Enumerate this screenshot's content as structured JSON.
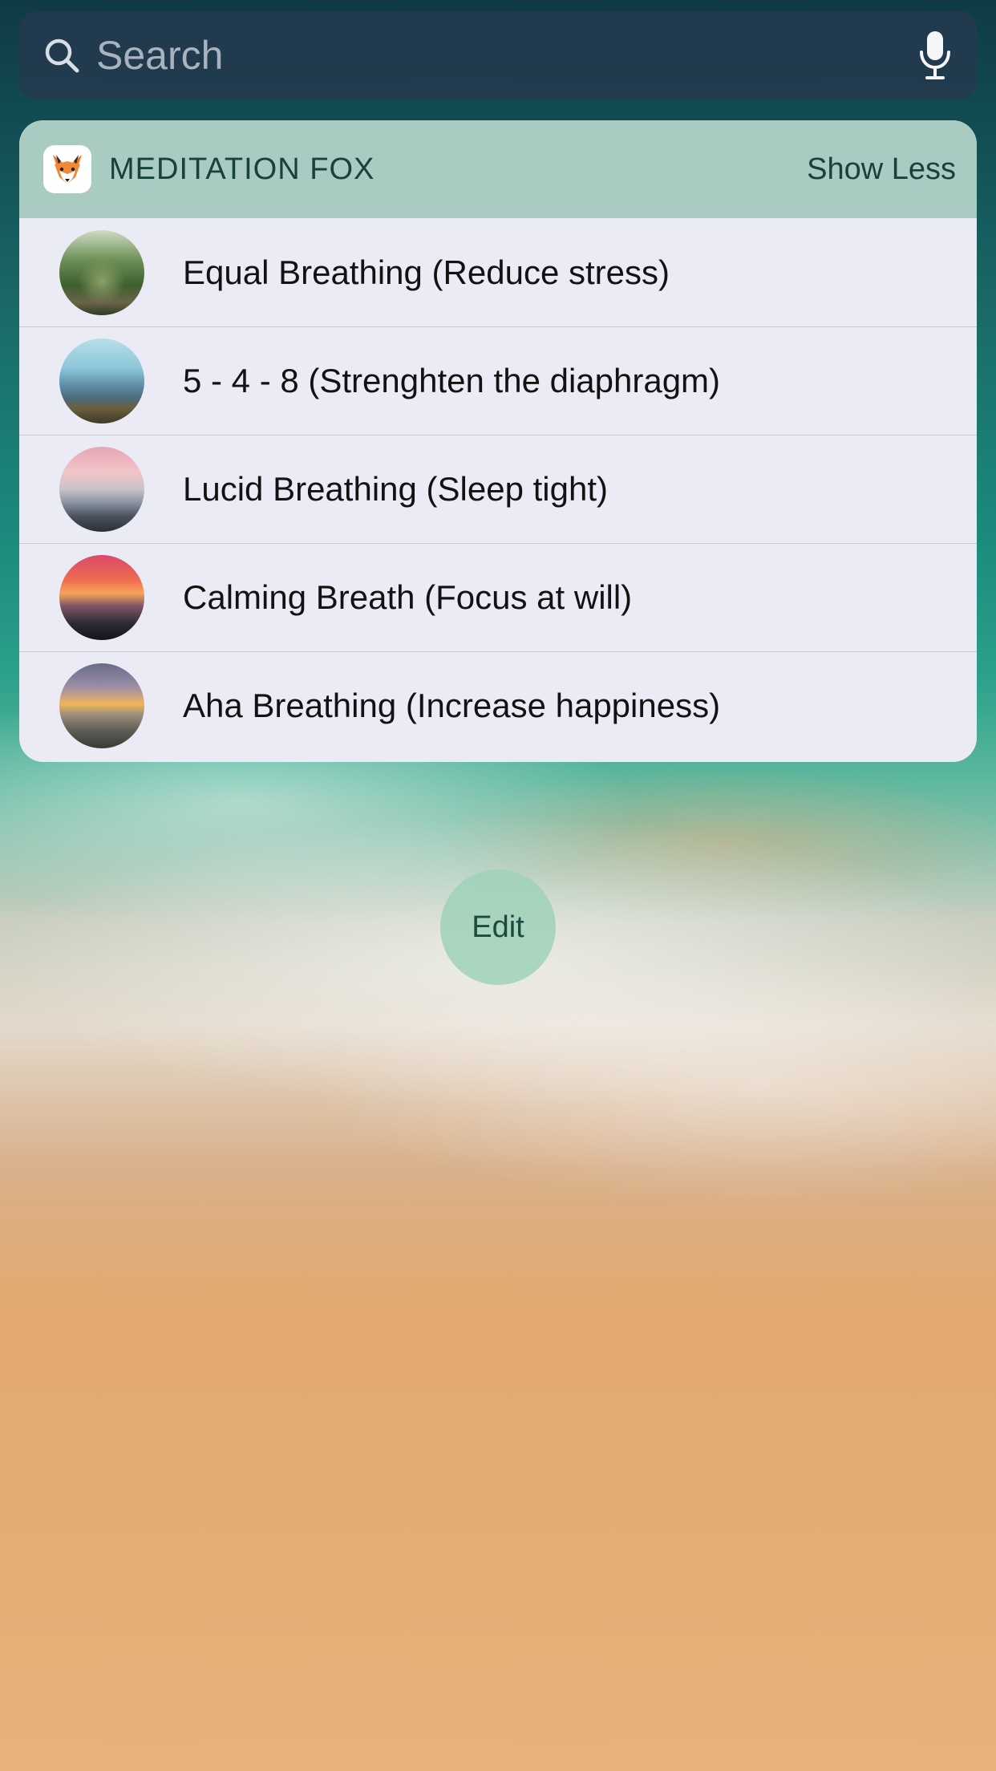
{
  "search": {
    "placeholder": "Search"
  },
  "icons": {
    "search": "search-icon",
    "mic": "microphone-icon",
    "app": "fox-icon"
  },
  "widget": {
    "app_name": "MEDITATION FOX",
    "show_less_label": "Show Less",
    "items": [
      {
        "title": "Equal Breathing (Reduce stress)",
        "thumb": "forest-path-image"
      },
      {
        "title": "5 - 4 - 8 (Strenghten the diaphragm)",
        "thumb": "mountain-lake-image"
      },
      {
        "title": "Lucid Breathing (Sleep tight)",
        "thumb": "pink-sky-mountains-image"
      },
      {
        "title": "Calming Breath (Focus at will)",
        "thumb": "sunset-sea-rocks-image"
      },
      {
        "title": "Aha Breathing (Increase happiness)",
        "thumb": "dusk-coast-image"
      }
    ]
  },
  "edit_label": "Edit",
  "colors": {
    "widget_header": "#a9cbc2",
    "widget_body": "#ebebf6",
    "header_text": "#17433b",
    "edit_button": "#a0d2b9"
  }
}
